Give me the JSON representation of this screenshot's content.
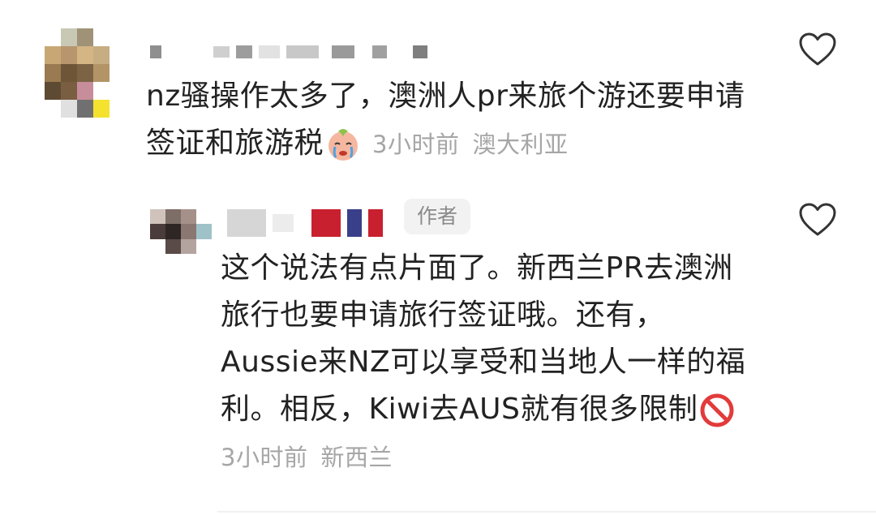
{
  "comments": [
    {
      "text": "nz骚操作太多了，澳洲人pr来旅个游还要申请签证和旅游税",
      "emoji": "crying-face-emoji",
      "time": "3小时前",
      "location": "澳大利亚"
    },
    {
      "author_tag": "作者",
      "text": "这个说法有点片面了。新西兰PR去澳洲旅行也要申请旅行签证哦。还有，Aussie来NZ可以享受和当地人一样的福利。相反，Kiwi去AUS就有很多限制",
      "emoji": "prohibited-emoji",
      "time": "3小时前",
      "location": "新西兰"
    }
  ],
  "icons": {
    "like": "heart-outline-icon"
  },
  "colors": {
    "meta_text": "#a6a6a6",
    "author_tag_bg": "#f2f2f2"
  }
}
